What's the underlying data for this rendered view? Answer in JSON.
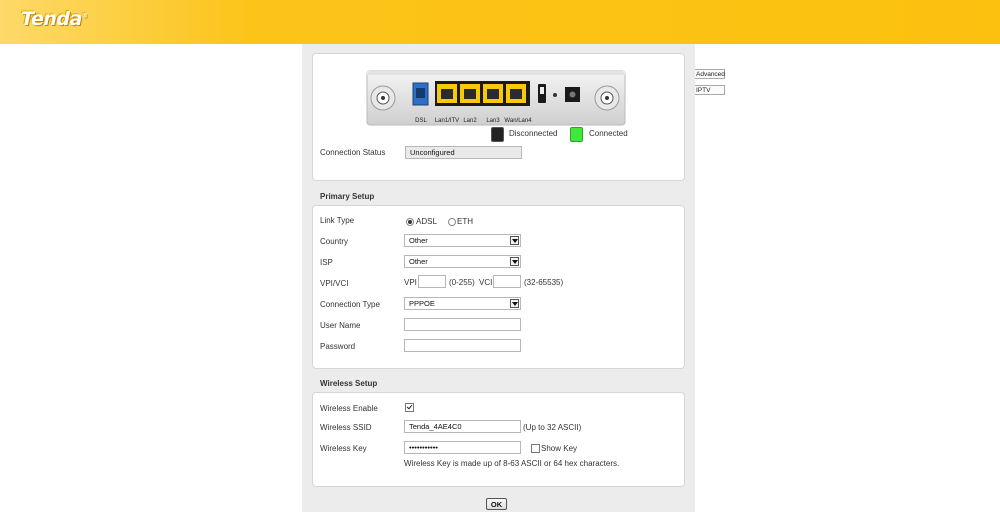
{
  "brand": {
    "logo_text": "Tenda",
    "logo_mark": "®"
  },
  "side_buttons": {
    "advanced": "Advanced",
    "iptv": "IPTV"
  },
  "router": {
    "ports": [
      "DSL",
      "Lan1/ITV",
      "Lan2",
      "Lan3",
      "Wan/Lan4"
    ],
    "legend_disconnected": "Disconnected",
    "legend_connected": "Connected",
    "colors": {
      "port_active": "#f7c90a",
      "dsl_port": "#2d6fc4",
      "connected": "#3fe83a",
      "disconnected": "#222222"
    }
  },
  "status": {
    "label": "Connection Status",
    "value": "Unconfigured"
  },
  "primary": {
    "title": "Primary Setup",
    "link_type_label": "Link Type",
    "link_type_options": [
      "ADSL",
      "ETH"
    ],
    "country_label": "Country",
    "country_value": "Other",
    "isp_label": "ISP",
    "isp_value": "Other",
    "vpivci_label": "VPI/VCI",
    "vpi_label": "VPI",
    "vpi_range": "(0-255)",
    "vci_label": "VCI",
    "vci_range": "(32-65535)",
    "conn_type_label": "Connection Type",
    "conn_type_value": "PPPOE",
    "username_label": "User Name",
    "password_label": "Password"
  },
  "wireless": {
    "title": "Wireless Setup",
    "enable_label": "Wireless Enable",
    "ssid_label": "Wireless SSID",
    "ssid_value": "Tenda_4AE4C0",
    "ssid_hint": "(Up to 32 ASCII)",
    "key_label": "Wireless Key",
    "key_value": "•••••••••••",
    "show_key_label": "Show Key",
    "key_hint": "Wireless Key is made up of 8-63 ASCII or 64 hex characters."
  },
  "ok_label": "OK"
}
